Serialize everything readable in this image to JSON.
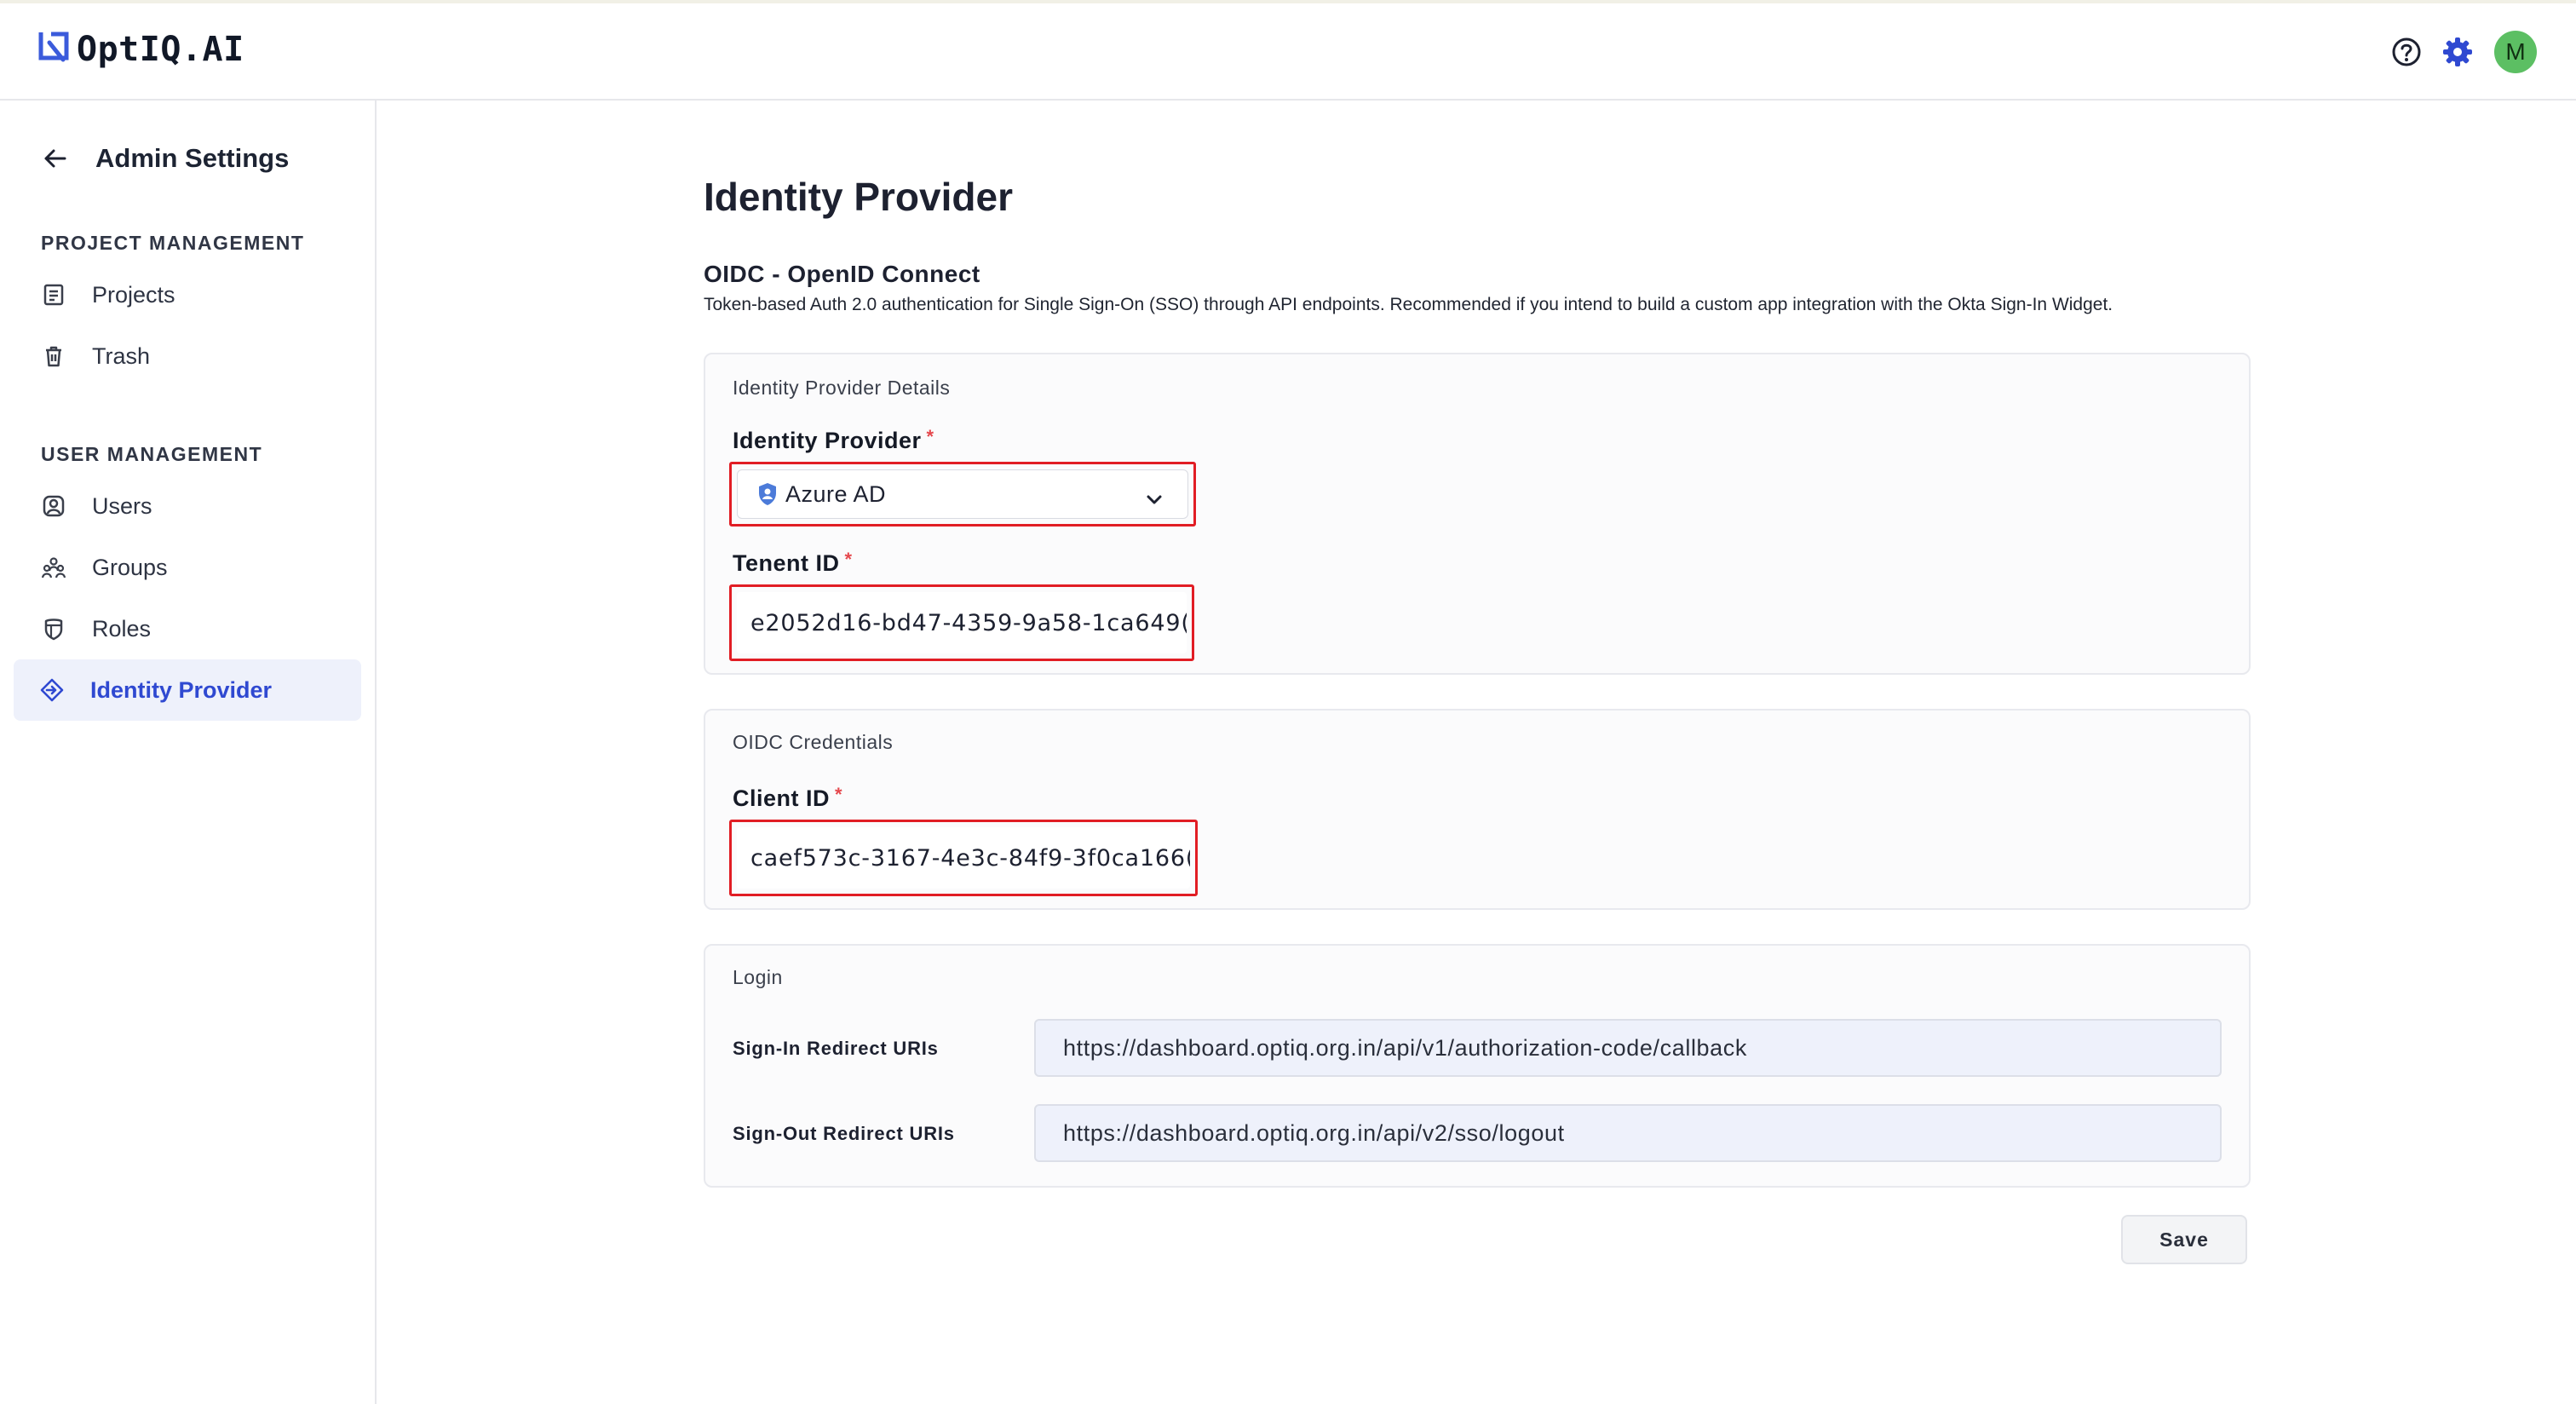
{
  "app": {
    "name": "OptIQ.AI"
  },
  "header": {
    "avatar_initial": "M",
    "accent_color": "#2f49d1",
    "avatar_color": "#5cbf63"
  },
  "sidebar": {
    "back_title": "Admin Settings",
    "sections": [
      {
        "label": "PROJECT MANAGEMENT",
        "items": [
          {
            "label": "Projects",
            "icon": "projects-icon"
          },
          {
            "label": "Trash",
            "icon": "trash-icon"
          }
        ]
      },
      {
        "label": "USER MANAGEMENT",
        "items": [
          {
            "label": "Users",
            "icon": "user-icon"
          },
          {
            "label": "Groups",
            "icon": "groups-icon"
          },
          {
            "label": "Roles",
            "icon": "roles-icon"
          },
          {
            "label": "Identity Provider",
            "icon": "identity-provider-icon",
            "active": true
          }
        ]
      }
    ]
  },
  "main": {
    "title": "Identity Provider",
    "oidc_title": "OIDC - OpenID Connect",
    "oidc_description": "Token-based Auth 2.0 authentication for Single Sign-On (SSO) through API endpoints. Recommended if you intend to build a custom app integration with the Okta Sign-In Widget.",
    "details_card": {
      "title": "Identity Provider Details",
      "provider_label": "Identity Provider",
      "provider_value": "Azure AD",
      "tenant_label": "Tenent ID",
      "tenant_value": "e2052d16-bd47-4359-9a58-1ca649("
    },
    "credentials_card": {
      "title": "OIDC Credentials",
      "client_label": "Client ID",
      "client_value": "caef573c-3167-4e3c-84f9-3f0ca166("
    },
    "login_card": {
      "title": "Login",
      "sign_in_label": "Sign-In Redirect URIs",
      "sign_in_value": "https://dashboard.optiq.org.in/api/v1/authorization-code/callback",
      "sign_out_label": "Sign-Out Redirect URIs",
      "sign_out_value": "https://dashboard.optiq.org.in/api/v2/sso/logout"
    },
    "required_mark": "*",
    "save_label": "Save"
  }
}
